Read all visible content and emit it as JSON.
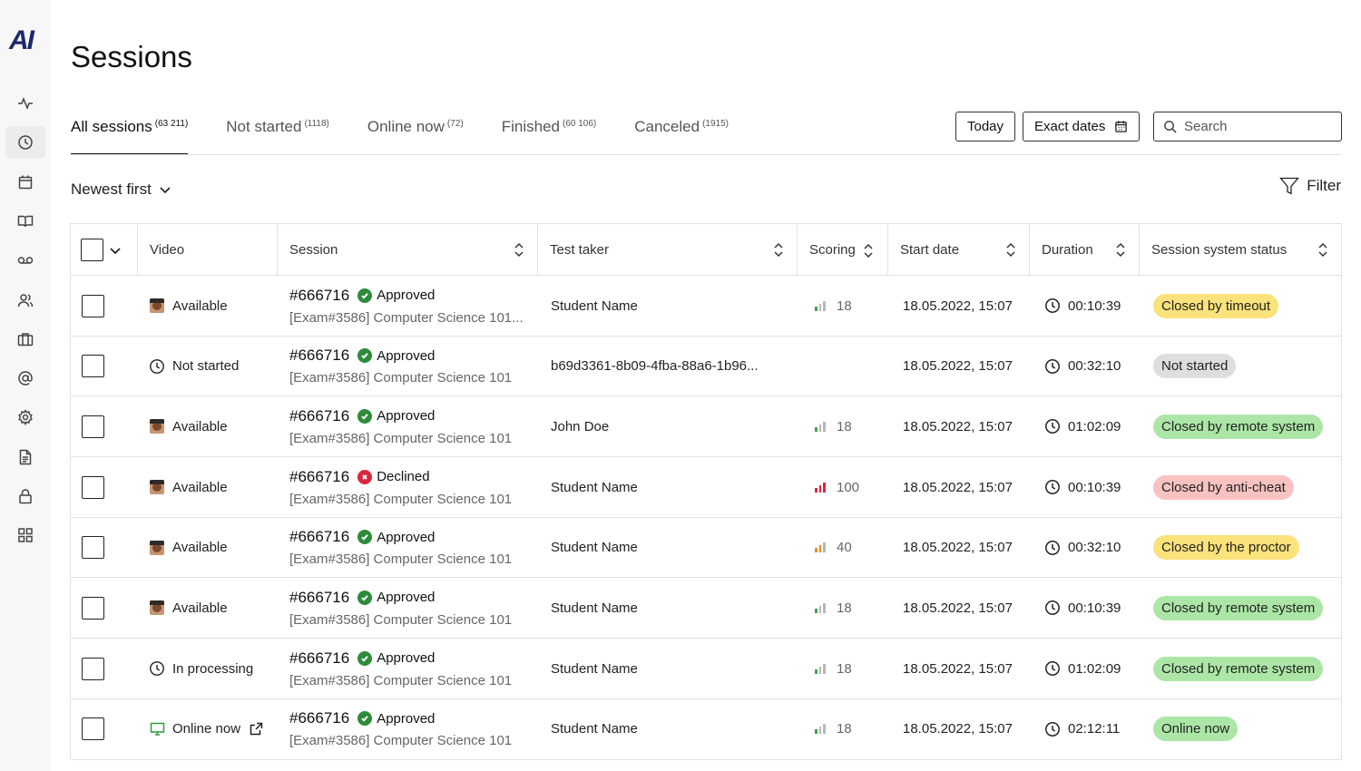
{
  "app": {
    "logo": "AI"
  },
  "sidebar": {
    "items": [
      {
        "name": "activity-icon",
        "active": false
      },
      {
        "name": "clock-icon",
        "active": true
      },
      {
        "name": "calendar-icon",
        "active": false
      },
      {
        "name": "book-icon",
        "active": false
      },
      {
        "name": "voicemail-icon",
        "active": false
      },
      {
        "name": "users-icon",
        "active": false
      },
      {
        "name": "briefcase-icon",
        "active": false
      },
      {
        "name": "at-icon",
        "active": false
      },
      {
        "name": "settings-icon",
        "active": false
      },
      {
        "name": "document-icon",
        "active": false
      },
      {
        "name": "lock-icon",
        "active": false
      },
      {
        "name": "grid-icon",
        "active": false
      }
    ]
  },
  "header": {
    "title": "Sessions"
  },
  "tabs": [
    {
      "label": "All sessions",
      "count": "(63 211)",
      "active": true
    },
    {
      "label": "Not started",
      "count": "(1118)",
      "active": false
    },
    {
      "label": "Online now",
      "count": "(72)",
      "active": false
    },
    {
      "label": "Finished",
      "count": "(60 106)",
      "active": false
    },
    {
      "label": "Canceled",
      "count": "(1915)",
      "active": false
    }
  ],
  "toolbar": {
    "today_label": "Today",
    "exact_dates_label": "Exact dates",
    "search_placeholder": "Search",
    "sort_label": "Newest first",
    "filter_label": "Filter"
  },
  "table": {
    "columns": {
      "video": "Video",
      "session": "Session",
      "taker": "Test taker",
      "scoring": "Scoring",
      "start": "Start date",
      "duration": "Duration",
      "status": "Session system status"
    },
    "rows": [
      {
        "video": "Available",
        "video_icon": "avatar",
        "id": "#666716",
        "review": "Approved",
        "review_ok": true,
        "exam": "[Exam#3586] Computer Science 101...",
        "taker": "Student Name",
        "score": "18",
        "score_level": 1,
        "date": "18.05.2022, 15:07",
        "duration": "00:10:39",
        "status": "Closed by timeout",
        "status_bg": "#fbe27a"
      },
      {
        "video": "Not started",
        "video_icon": "clock",
        "id": "#666716",
        "review": "Approved",
        "review_ok": true,
        "exam": "[Exam#3586] Computer Science 101",
        "taker": "b69d3361-8b09-4fba-88a6-1b96...",
        "score": "",
        "score_level": 0,
        "date": "18.05.2022, 15:07",
        "duration": "00:32:10",
        "status": "Not started",
        "status_bg": "#dedede"
      },
      {
        "video": "Available",
        "video_icon": "avatar",
        "id": "#666716",
        "review": "Approved",
        "review_ok": true,
        "exam": "[Exam#3586] Computer Science 101",
        "taker": "John Doe",
        "score": "18",
        "score_level": 1,
        "date": "18.05.2022, 15:07",
        "duration": "01:02:09",
        "status": "Closed by remote system",
        "status_bg": "#ace6a6"
      },
      {
        "video": "Available",
        "video_icon": "avatar",
        "id": "#666716",
        "review": "Declined",
        "review_ok": false,
        "exam": "[Exam#3586] Computer Science 101",
        "taker": "Student Name",
        "score": "100",
        "score_level": 3,
        "date": "18.05.2022, 15:07",
        "duration": "00:10:39",
        "status": "Closed by anti-cheat",
        "status_bg": "#f7c2c0"
      },
      {
        "video": "Available",
        "video_icon": "avatar",
        "id": "#666716",
        "review": "Approved",
        "review_ok": true,
        "exam": "[Exam#3586] Computer Science 101",
        "taker": "Student Name",
        "score": "40",
        "score_level": 2,
        "date": "18.05.2022, 15:07",
        "duration": "00:32:10",
        "status": "Closed by the proctor",
        "status_bg": "#fbe27a"
      },
      {
        "video": "Available",
        "video_icon": "avatar",
        "id": "#666716",
        "review": "Approved",
        "review_ok": true,
        "exam": "[Exam#3586] Computer Science 101",
        "taker": "Student Name",
        "score": "18",
        "score_level": 1,
        "date": "18.05.2022, 15:07",
        "duration": "00:10:39",
        "status": "Closed by remote system",
        "status_bg": "#ace6a6"
      },
      {
        "video": "In processing",
        "video_icon": "clock",
        "id": "#666716",
        "review": "Approved",
        "review_ok": true,
        "exam": "[Exam#3586] Computer Science 101",
        "taker": "Student Name",
        "score": "18",
        "score_level": 1,
        "date": "18.05.2022, 15:07",
        "duration": "01:02:09",
        "status": "Closed by remote system",
        "status_bg": "#ace6a6"
      },
      {
        "video": "Online now",
        "video_icon": "monitor",
        "id": "#666716",
        "review": "Approved",
        "review_ok": true,
        "exam": "[Exam#3586] Computer Science 101",
        "taker": "Student Name",
        "score": "18",
        "score_level": 1,
        "date": "18.05.2022, 15:07",
        "duration": "02:12:11",
        "status": "Online now",
        "status_bg": "#ace6a6"
      }
    ]
  }
}
